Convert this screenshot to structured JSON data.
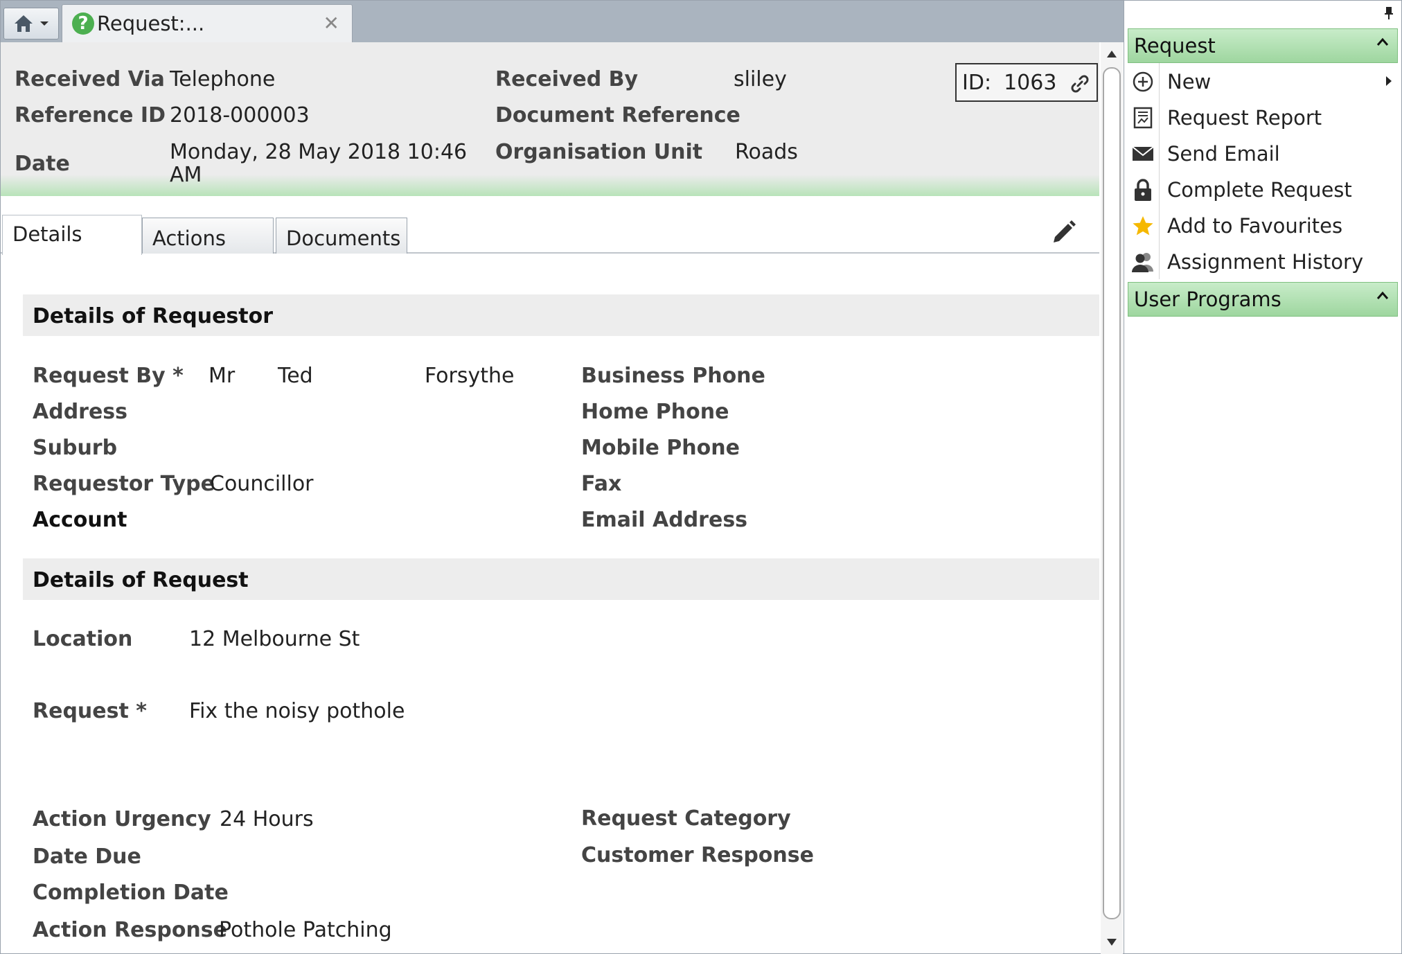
{
  "tab": {
    "title": "Request:..."
  },
  "header": {
    "received_via_label": "Received Via",
    "received_via": "Telephone",
    "reference_id_label": "Reference ID",
    "reference_id": "2018-000003",
    "date_label": "Date",
    "date_line1": "Monday, 28 May 2018 10:46",
    "date_line2": "AM",
    "received_by_label": "Received By",
    "received_by": "sliley",
    "document_reference_label": "Document Reference",
    "org_unit_label": "Organisation Unit",
    "org_unit": "Roads",
    "id_label": "ID:",
    "id_value": "1063"
  },
  "tabs": [
    "Details",
    "Actions",
    "Documents"
  ],
  "requestor": {
    "section_title": "Details of Requestor",
    "request_by_label": "Request By *",
    "title": "Mr",
    "first_name": "Ted",
    "last_name": "Forsythe",
    "address_label": "Address",
    "suburb_label": "Suburb",
    "requestor_type_label": "Requestor Type",
    "requestor_type": "Councillor",
    "account_label": "Account",
    "business_phone_label": "Business Phone",
    "home_phone_label": "Home Phone",
    "mobile_phone_label": "Mobile Phone",
    "fax_label": "Fax",
    "email_label": "Email Address"
  },
  "request": {
    "section_title": "Details of Request",
    "location_label": "Location",
    "location": "12 Melbourne St",
    "request_label": "Request *",
    "request": "Fix the noisy pothole",
    "urgency_label": "Action Urgency",
    "urgency": "24 Hours",
    "date_due_label": "Date Due",
    "completion_date_label": "Completion Date",
    "action_response_label": "Action Response",
    "action_response": "Pothole Patching",
    "category_label": "Request Category",
    "customer_response_label": "Customer Response"
  },
  "sidebar": {
    "request_header": "Request",
    "items": [
      {
        "label": "New",
        "icon": "plus-circle-icon"
      },
      {
        "label": "Request Report",
        "icon": "report-icon"
      },
      {
        "label": "Send Email",
        "icon": "envelope-icon"
      },
      {
        "label": "Complete Request",
        "icon": "lock-icon"
      },
      {
        "label": "Add to Favourites",
        "icon": "star-icon"
      },
      {
        "label": "Assignment History",
        "icon": "users-icon"
      }
    ],
    "user_programs_header": "User Programs"
  },
  "colors": {
    "accent_green": "#9ed69f",
    "header_bg": "#ececec",
    "star": "#f5b800"
  }
}
